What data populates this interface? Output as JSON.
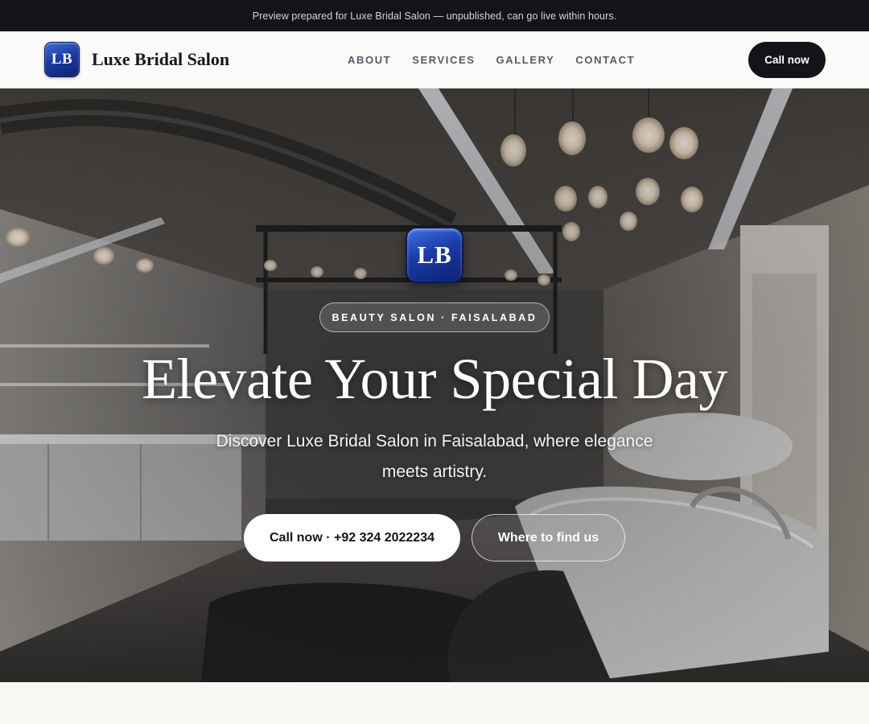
{
  "preview_bar": {
    "text": "Preview prepared for Luxe Bridal Salon — unpublished, can go live within hours."
  },
  "header": {
    "logo_text": "LB",
    "brand_name": "Luxe Bridal Salon",
    "nav": [
      "ABOUT",
      "SERVICES",
      "GALLERY",
      "CONTACT"
    ],
    "call_button": "Call now"
  },
  "hero": {
    "logo_text": "LB",
    "eyebrow": "BEAUTY SALON · FAISALABAD",
    "title": "Elevate Your Special Day",
    "subtitle": "Discover Luxe Bridal Salon in Faisalabad, where elegance meets artistry.",
    "primary_cta": "Call now · +92 324 2022234",
    "secondary_cta": "Where to find us"
  },
  "colors": {
    "dark": "#12141a",
    "logo_blue": "#1b3ca6",
    "page_background": "#f8f7f4"
  }
}
